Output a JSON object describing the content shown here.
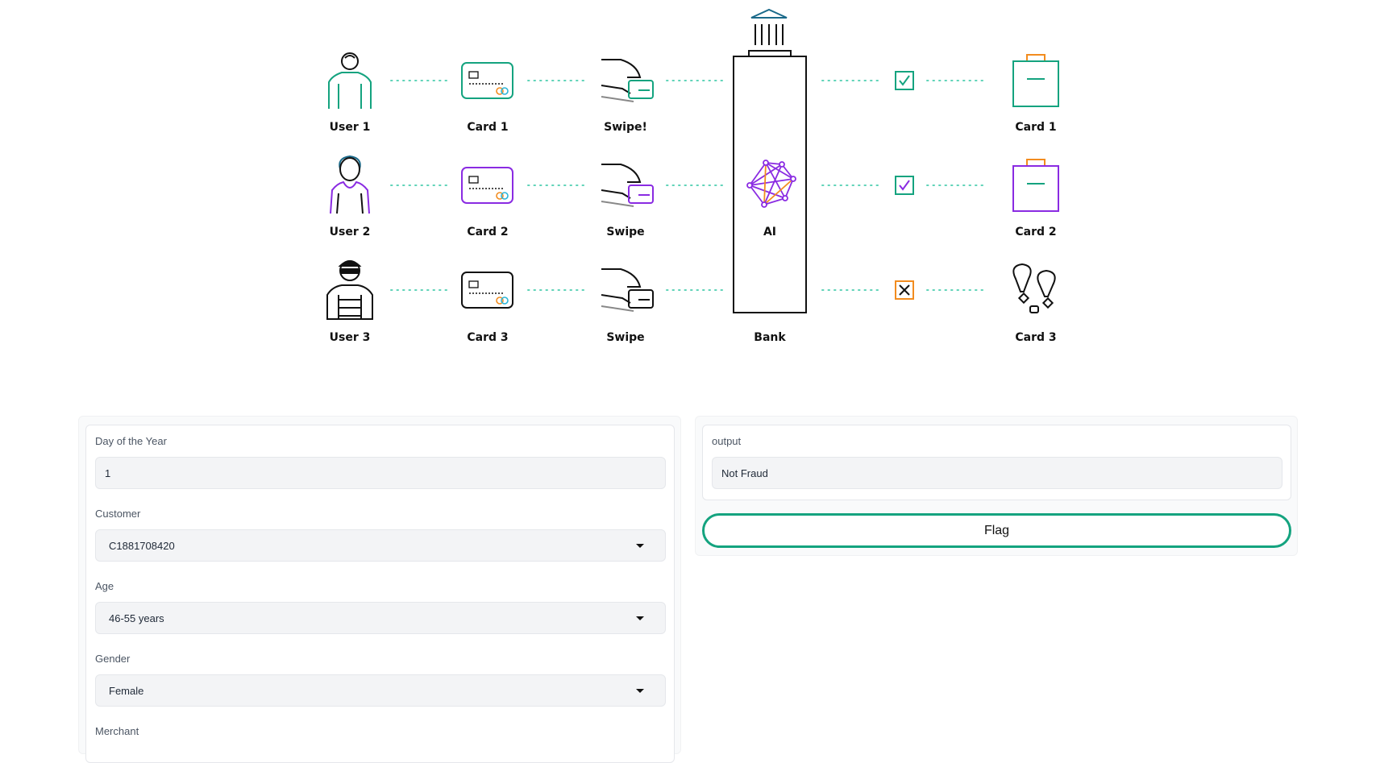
{
  "diagram": {
    "rows": [
      {
        "user": "User 1",
        "card": "Card 1",
        "swipe": "Swipe!",
        "result_card": "Card 1",
        "status": "approved"
      },
      {
        "user": "User 2",
        "card": "Card 2",
        "swipe": "Swipe",
        "result_card": "Card 2",
        "status": "approved"
      },
      {
        "user": "User 3",
        "card": "Card 3",
        "swipe": "Swipe",
        "result_card": "Card 3",
        "status": "rejected"
      }
    ],
    "ai_label": "AI",
    "bank_label": "Bank",
    "colors": {
      "teal": "#14a37f",
      "purple": "#8a2be2",
      "orange": "#f28c1f",
      "black": "#111111"
    }
  },
  "form": {
    "day_of_year": {
      "label": "Day of the Year",
      "value": "1"
    },
    "customer": {
      "label": "Customer",
      "value": "C1881708420"
    },
    "age": {
      "label": "Age",
      "value": "46-55 years"
    },
    "gender": {
      "label": "Gender",
      "value": "Female"
    },
    "merchant": {
      "label": "Merchant"
    }
  },
  "output": {
    "label": "output",
    "value": "Not Fraud"
  },
  "flag_button": {
    "label": "Flag"
  }
}
